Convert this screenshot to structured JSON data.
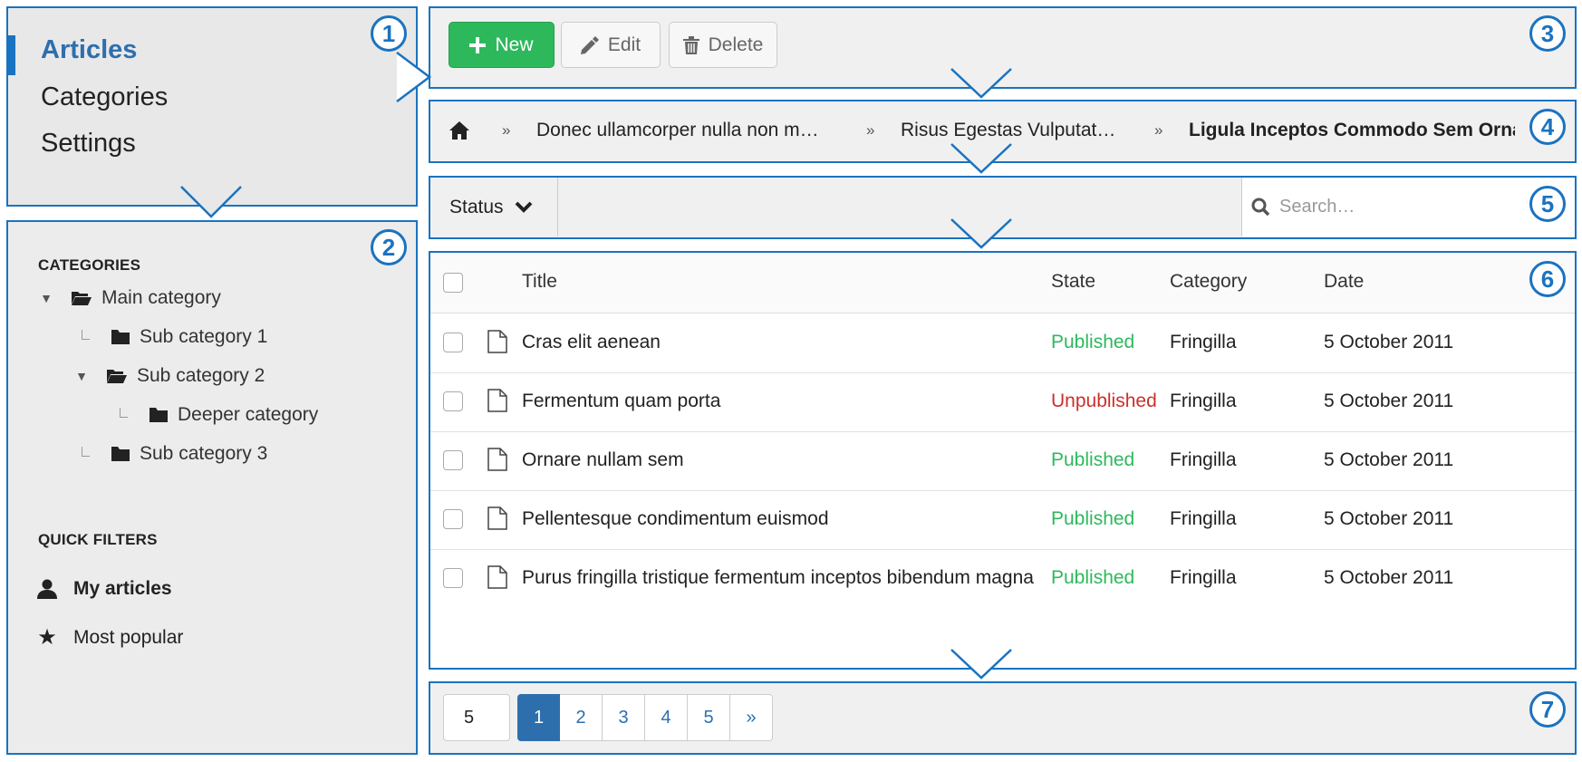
{
  "colors": {
    "accent": "#1a73c0",
    "link": "#2d6fad",
    "published": "#2eb85c",
    "unpublished": "#c9302c",
    "new_button": "#2eb85c"
  },
  "badges": [
    "1",
    "2",
    "3",
    "4",
    "5",
    "6",
    "7"
  ],
  "nav": {
    "items": [
      {
        "label": "Articles",
        "active": true
      },
      {
        "label": "Categories",
        "active": false
      },
      {
        "label": "Settings",
        "active": false
      }
    ]
  },
  "sidebar": {
    "categories_heading": "CATEGORIES",
    "tree": [
      {
        "label": "Main category",
        "level": 0,
        "toggle": "expanded",
        "icon": "folder-open-icon"
      },
      {
        "label": "Sub category 1",
        "level": 1,
        "toggle": "leaf",
        "icon": "folder-icon"
      },
      {
        "label": "Sub category 2",
        "level": 1,
        "toggle": "expanded",
        "icon": "folder-open-icon"
      },
      {
        "label": "Deeper category",
        "level": 2,
        "toggle": "leaf",
        "icon": "folder-icon"
      },
      {
        "label": "Sub category 3",
        "level": 1,
        "toggle": "leaf",
        "icon": "folder-icon"
      }
    ],
    "quick_filters_heading": "QUICK FILTERS",
    "quick_filters": [
      {
        "label": "My articles",
        "icon": "user-icon",
        "bold": true
      },
      {
        "label": "Most popular",
        "icon": "star-icon",
        "bold": false
      }
    ]
  },
  "toolbar": {
    "new_label": "New",
    "edit_label": "Edit",
    "delete_label": "Delete"
  },
  "breadcrumb": {
    "separator": "»",
    "items": [
      "Donec ullamcorper nulla non m…",
      "Risus Egestas Vulputat…",
      "Ligula Inceptos Commodo Sem Orna"
    ]
  },
  "filter": {
    "status_label": "Status",
    "search_placeholder": "Search…"
  },
  "table": {
    "columns": [
      "Title",
      "State",
      "Category",
      "Date"
    ],
    "rows": [
      {
        "title": "Cras elit aenean",
        "state": "Published",
        "category": "Fringilla",
        "date": "5 October 2011"
      },
      {
        "title": "Fermentum quam porta",
        "state": "Unpublished",
        "category": "Fringilla",
        "date": "5 October 2011"
      },
      {
        "title": "Ornare nullam sem",
        "state": "Published",
        "category": "Fringilla",
        "date": "5 October 2011"
      },
      {
        "title": "Pellentesque condimentum euismod",
        "state": "Published",
        "category": "Fringilla",
        "date": "5 October 2011"
      },
      {
        "title": "Purus fringilla tristique fermentum inceptos bibendum magna",
        "state": "Published",
        "category": "Fringilla",
        "date": "5 October 2011"
      }
    ]
  },
  "pagination": {
    "limit": "5",
    "pages": [
      "1",
      "2",
      "3",
      "4",
      "5"
    ],
    "next_label": "»",
    "current": "1"
  }
}
